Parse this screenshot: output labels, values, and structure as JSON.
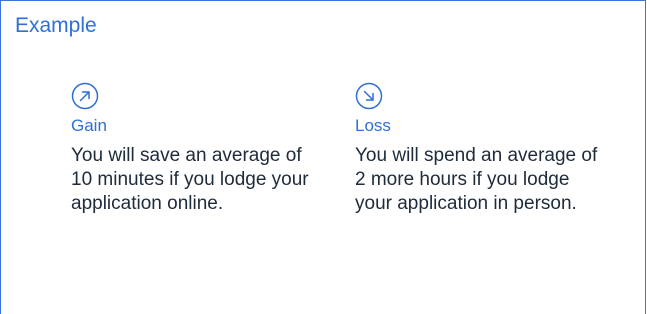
{
  "card": {
    "title": "Example",
    "accent_color": "#2f6fd6"
  },
  "items": [
    {
      "icon": "arrow-up-right-icon",
      "label": "Gain",
      "lines": [
        "You will save an average of",
        "10 minutes if you lodge your",
        "application online."
      ]
    },
    {
      "icon": "arrow-down-right-icon",
      "label": "Loss",
      "lines": [
        "You will spend an average of",
        "2 more hours if you lodge",
        "your application in person."
      ]
    }
  ]
}
